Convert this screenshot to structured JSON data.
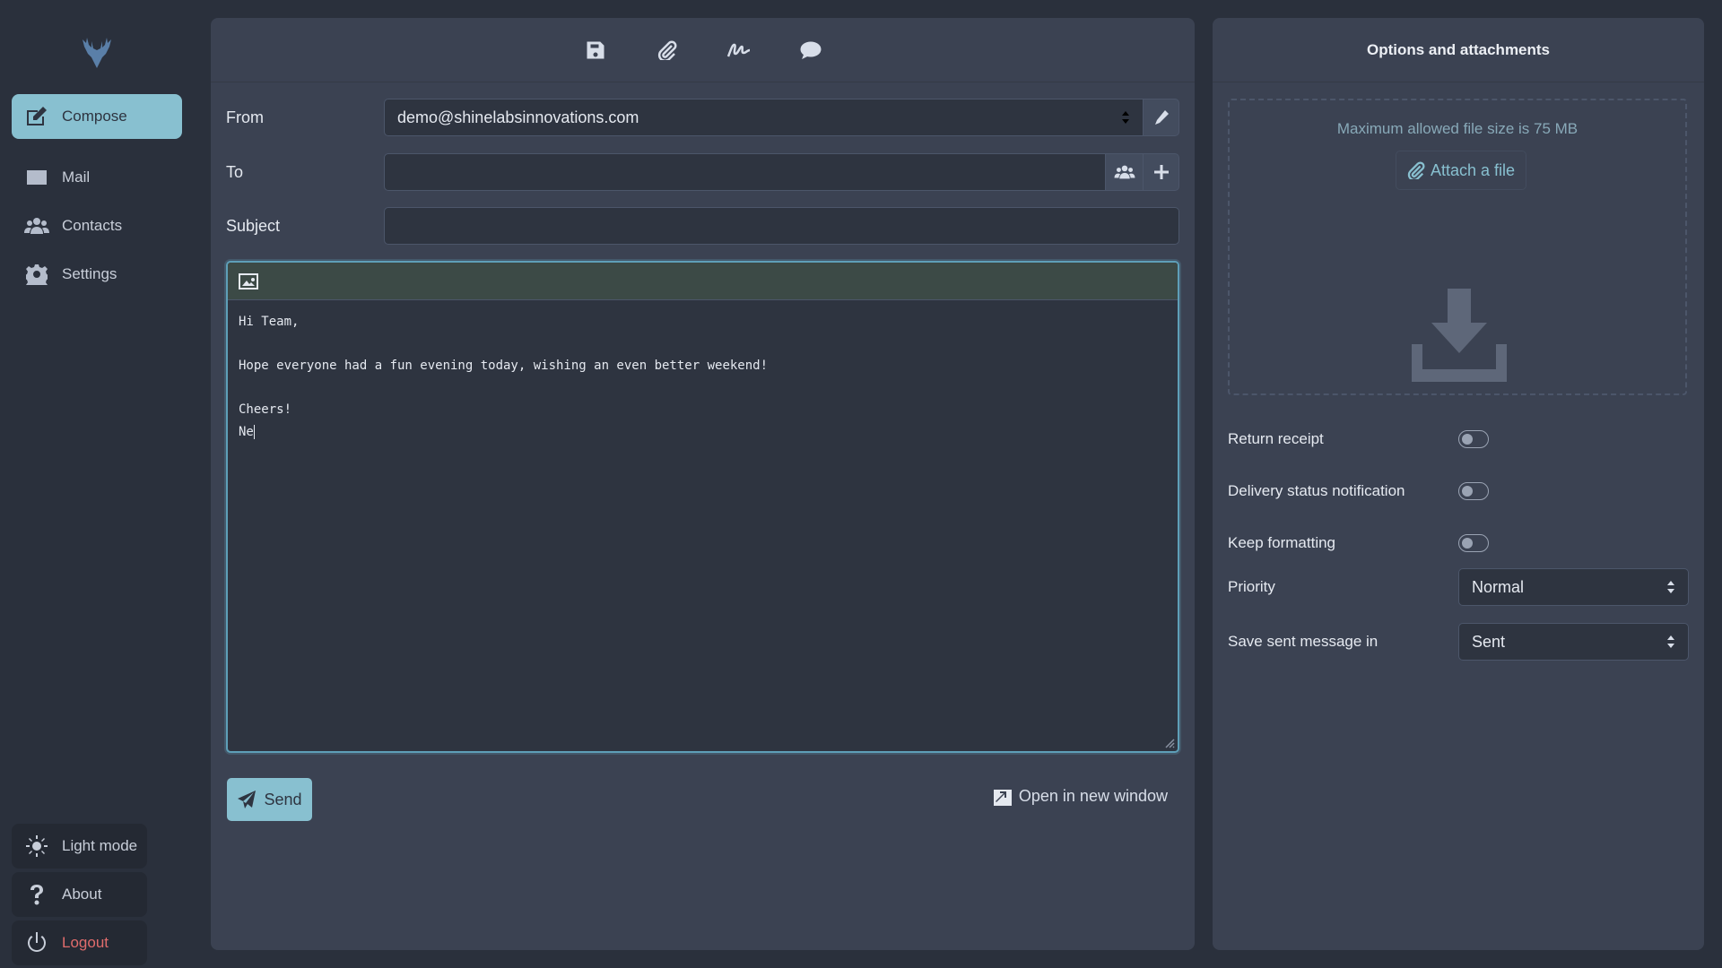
{
  "sidebar": {
    "logo_icon": "deer-head-icon",
    "nav": [
      {
        "label": "Compose",
        "icon": "compose-icon",
        "active": true
      },
      {
        "label": "Mail",
        "icon": "envelope-icon"
      },
      {
        "label": "Contacts",
        "icon": "users-icon"
      },
      {
        "label": "Settings",
        "icon": "gear-icon"
      }
    ],
    "bottom": [
      {
        "label": "Light mode",
        "icon": "sun-icon"
      },
      {
        "label": "About",
        "icon": "question-icon"
      },
      {
        "label": "Logout",
        "icon": "power-icon"
      }
    ]
  },
  "compose": {
    "toolbar": [
      "save-icon",
      "paperclip-icon",
      "signature-icon",
      "comment-icon"
    ],
    "from": {
      "label": "From",
      "value": "demo@shinelabsinnovations.com"
    },
    "to": {
      "label": "To",
      "value": ""
    },
    "subject": {
      "label": "Subject",
      "value": ""
    },
    "body": "Hi Team,\n\nHope everyone had a fun evening today, wishing an even better weekend!\n\nCheers!\nNe",
    "send_label": "Send",
    "open_new_window_label": "Open in new window"
  },
  "options": {
    "title": "Options and attachments",
    "max_file_size": "Maximum allowed file size is 75 MB",
    "attach_label": "Attach a file",
    "return_receipt": {
      "label": "Return receipt",
      "on": false
    },
    "delivery_status": {
      "label": "Delivery status notification",
      "on": false
    },
    "keep_formatting": {
      "label": "Keep formatting",
      "on": false
    },
    "priority": {
      "label": "Priority",
      "value": "Normal"
    },
    "save_sent": {
      "label": "Save sent message in",
      "value": "Sent"
    }
  },
  "colors": {
    "background": "#2a303c",
    "panel": "#3b4252",
    "accent": "#88c0d0",
    "logout": "#e06c6c"
  }
}
